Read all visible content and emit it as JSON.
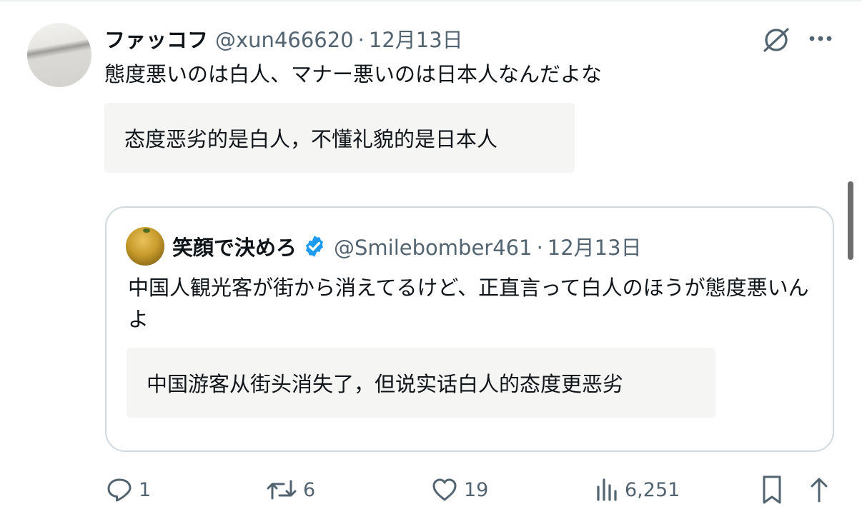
{
  "post": {
    "display_name": "ファッコフ",
    "handle": "@xun466620",
    "separator": "·",
    "date": "12月13日",
    "text": "態度悪いのは白人、マナー悪いのは日本人なんだよな",
    "translation": "态度恶劣的是白人，不懂礼貌的是日本人"
  },
  "quoted_post": {
    "display_name": "笑顔で決めろ",
    "handle": "@Smilebomber461",
    "separator": "·",
    "date": "12月13日",
    "text": "中国人観光客が街から消えてるけど、正直言って白人のほうが態度悪いんよ",
    "translation": "中国游客从街头消失了，但说实话白人的态度更恶劣"
  },
  "actions": {
    "replies": "1",
    "reposts": "6",
    "likes": "19",
    "views": "6,251"
  },
  "icons": {
    "grok": "grok-icon",
    "more": "more-icon",
    "verified": "verified-badge-icon",
    "reply": "reply-icon",
    "repost": "repost-icon",
    "like": "heart-icon",
    "views": "views-icon",
    "bookmark": "bookmark-icon",
    "share": "share-icon"
  },
  "colors": {
    "text": "#0f1419",
    "secondary": "#536471",
    "verified": "#1d9bf0",
    "border": "#cfd9de",
    "translation_bg": "#f5f5f4"
  }
}
